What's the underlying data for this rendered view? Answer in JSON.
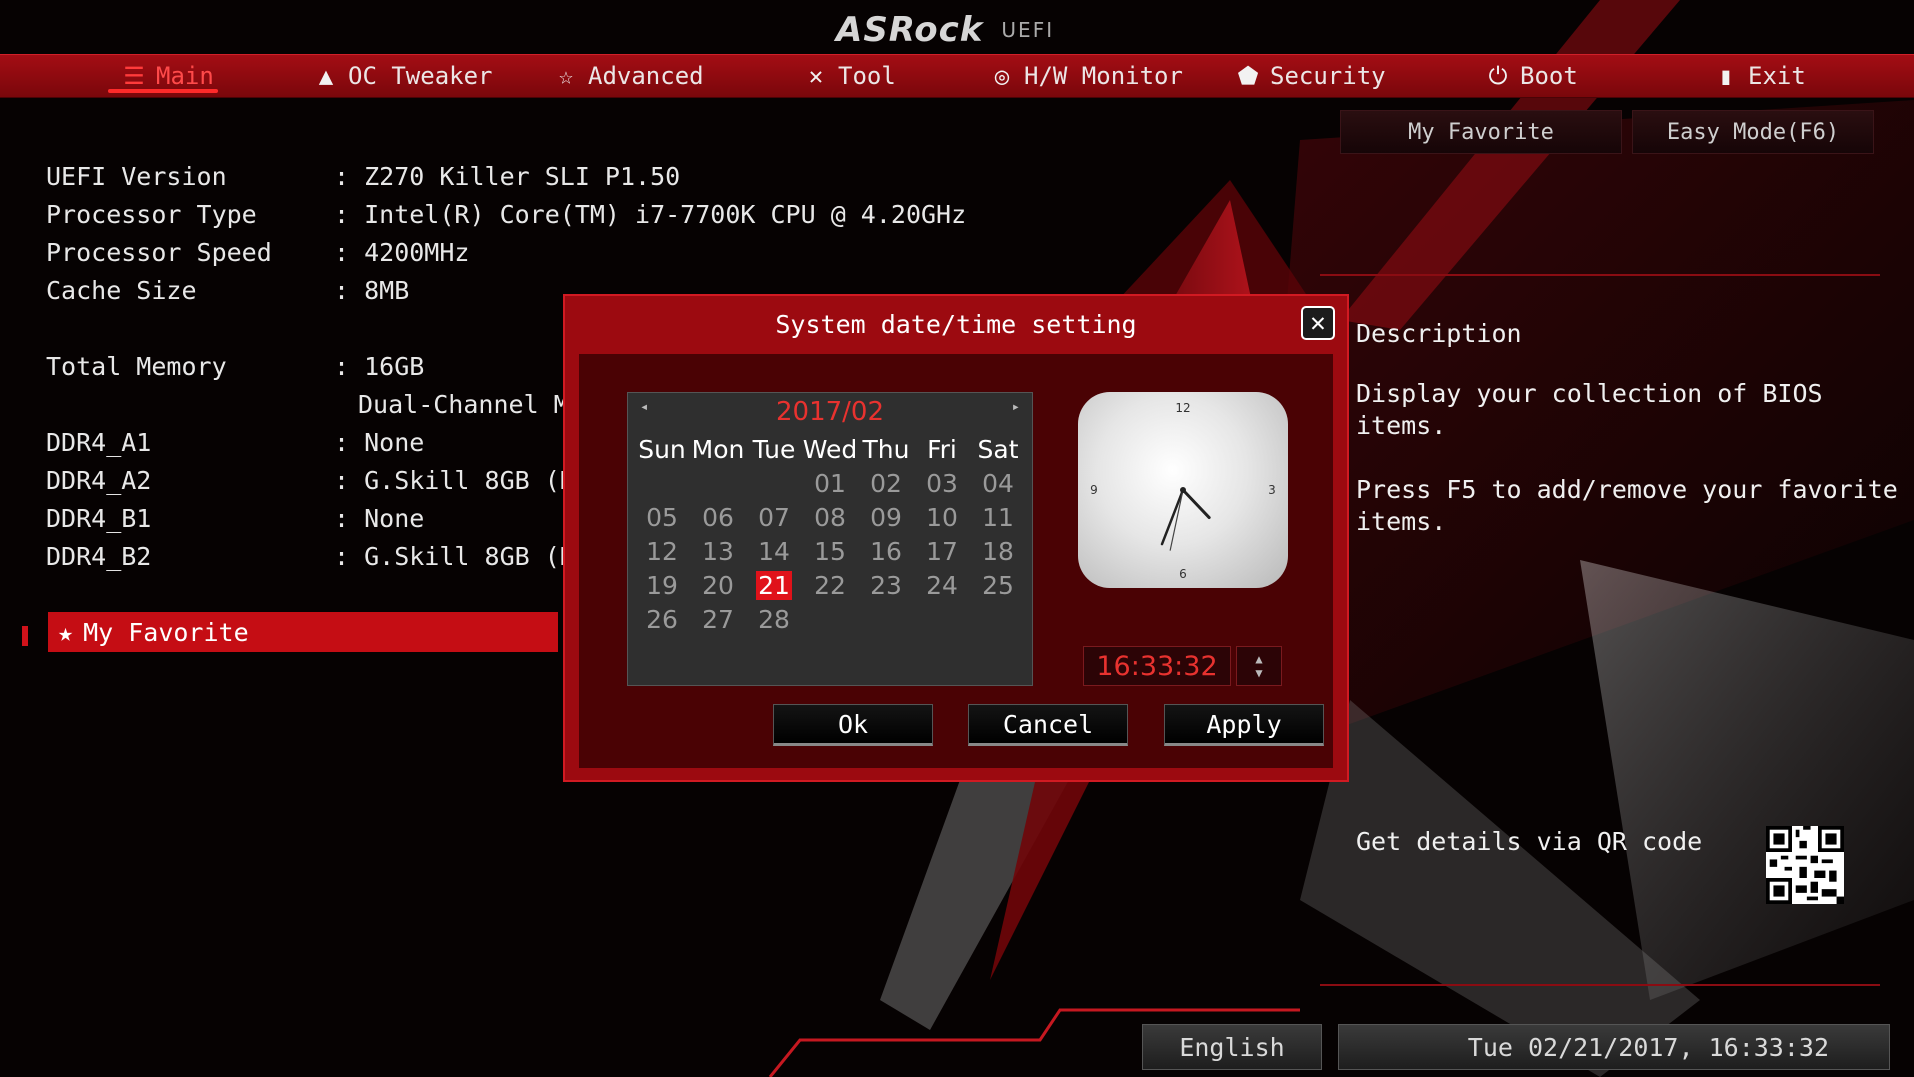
{
  "brand": {
    "name": "ASRock",
    "sub": "UEFI"
  },
  "nav": [
    {
      "label": "Main",
      "icon": "list-icon"
    },
    {
      "label": "OC Tweaker",
      "icon": "rocket-icon"
    },
    {
      "label": "Advanced",
      "icon": "star-icon"
    },
    {
      "label": "Tool",
      "icon": "tools-icon"
    },
    {
      "label": "H/W Monitor",
      "icon": "monitor-icon"
    },
    {
      "label": "Security",
      "icon": "shield-icon"
    },
    {
      "label": "Boot",
      "icon": "power-icon"
    },
    {
      "label": "Exit",
      "icon": "exit-icon"
    }
  ],
  "top_buttons": {
    "favorite": "My Favorite",
    "easy_mode": "Easy Mode(F6)"
  },
  "system_info": [
    {
      "label": "UEFI Version",
      "value": ": Z270 Killer SLI P1.50"
    },
    {
      "label": "Processor Type",
      "value": ": Intel(R) Core(TM) i7-7700K CPU @ 4.20GHz"
    },
    {
      "label": "Processor Speed",
      "value": ": 4200MHz"
    },
    {
      "label": "Cache Size",
      "value": ": 8MB"
    },
    {
      "label": "Total Memory",
      "value": ": 16GB"
    },
    {
      "label": "",
      "value": "Dual-Channel Memory Mode"
    },
    {
      "label": "DDR4_A1",
      "value": ": None"
    },
    {
      "label": "DDR4_A2",
      "value": ": G.Skill 8GB (DDR4-2400)"
    },
    {
      "label": "DDR4_B1",
      "value": ": None"
    },
    {
      "label": "DDR4_B2",
      "value": ": G.Skill 8GB (DDR4-2400)"
    }
  ],
  "favorite_item": "My Favorite",
  "description": {
    "title": "Description",
    "line1a": "Display your collection of BIOS",
    "line1b": "items.",
    "line2a": "Press F5 to add/remove your favorite",
    "line2b": "items.",
    "qr_text": "Get details via QR code"
  },
  "bottom": {
    "language": "English",
    "datetime": "Tue 02/21/2017, 16:33:32"
  },
  "dialog": {
    "title": "System date/time setting",
    "month": "2017/02",
    "weekdays": [
      "Sun",
      "Mon",
      "Tue",
      "Wed",
      "Thu",
      "Fri",
      "Sat"
    ],
    "weeks": [
      [
        "",
        "",
        "",
        "01",
        "02",
        "03",
        "04"
      ],
      [
        "05",
        "06",
        "07",
        "08",
        "09",
        "10",
        "11"
      ],
      [
        "12",
        "13",
        "14",
        "15",
        "16",
        "17",
        "18"
      ],
      [
        "19",
        "20",
        "21",
        "22",
        "23",
        "24",
        "25"
      ],
      [
        "26",
        "27",
        "28",
        "",
        "",
        "",
        ""
      ]
    ],
    "selected_day": "21",
    "clock": {
      "hour": 16,
      "minute": 33,
      "second": 32,
      "n12": "12",
      "n3": "3",
      "n6": "6",
      "n9": "9"
    },
    "time": "16:33:32",
    "ok": "Ok",
    "cancel": "Cancel",
    "apply": "Apply"
  },
  "colors": {
    "accent": "#c50d14",
    "highlight": "#e8322f",
    "nav_bg": "#8f0a10"
  }
}
